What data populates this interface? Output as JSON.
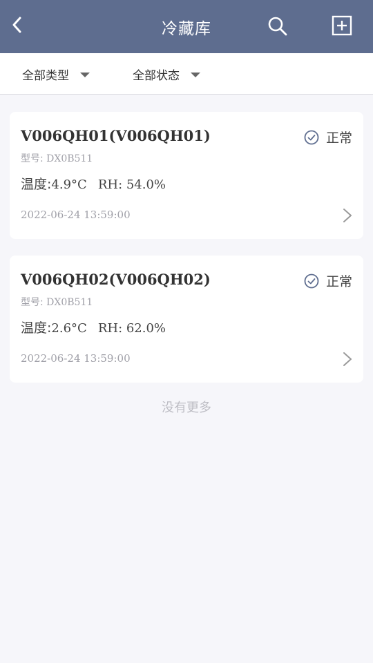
{
  "header": {
    "title": "冷藏库"
  },
  "filters": {
    "type_label": "全部类型",
    "status_label": "全部状态"
  },
  "devices": [
    {
      "name": "V006QH01(V006QH01)",
      "model_label": "型号: ",
      "model": "DX0B511",
      "temp_label": "温度: ",
      "temp": "4.9°C",
      "rh": "RH: 54.0%",
      "timestamp": "2022-06-24 13:59:00",
      "status": "正常"
    },
    {
      "name": "V006QH02(V006QH02)",
      "model_label": "型号: ",
      "model": "DX0B511",
      "temp_label": "温度: ",
      "temp": "2.6°C",
      "rh": "RH: 62.0%",
      "timestamp": "2022-06-24 13:59:00",
      "status": "正常"
    }
  ],
  "footer": {
    "no_more": "没有更多"
  },
  "colors": {
    "header_bg": "#5e6d8f",
    "page_bg": "#f6f6fa",
    "status_icon": "#5e6d8f"
  }
}
